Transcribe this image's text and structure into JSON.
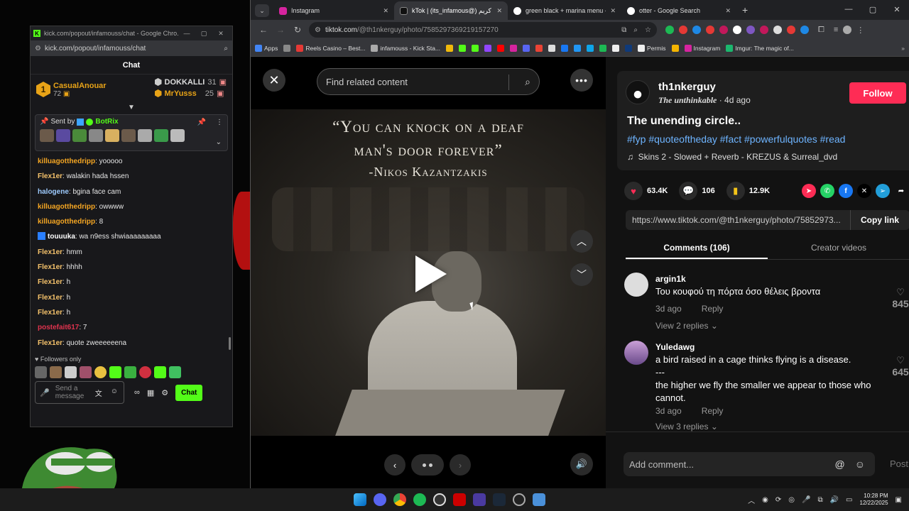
{
  "chat_window": {
    "title": "kick.com/popout/infamouss/chat - Google Chro...",
    "url": "kick.com/popout/infamouss/chat",
    "header": "Chat",
    "leaders": [
      {
        "rank": "1",
        "name": "CasualAnouar",
        "count": "72"
      },
      {
        "name": "DOKKALLI",
        "count": "31"
      },
      {
        "name": "MrYusss",
        "count": "25"
      }
    ],
    "pinned": {
      "label": "Sent by",
      "sender": "BotRix"
    },
    "messages": [
      {
        "user": "killuagotthedripp",
        "color": "#f5a623",
        "text": ": yooooo"
      },
      {
        "user": "Flex1er",
        "color": "#f5c26b",
        "text": ": walakin hada hssen"
      },
      {
        "user": "halogene",
        "color": "#9ecbff",
        "text": ": bgina face cam"
      },
      {
        "user": "killuagotthedripp",
        "color": "#f5a623",
        "text": ": owwww"
      },
      {
        "user": "killuagotthedripp",
        "color": "#f5a623",
        "text": ": 8"
      },
      {
        "user": "touuuka",
        "color": "#ffffff",
        "text": ": wa n9ess shwiaaaaaaaaa"
      },
      {
        "user": "Flex1er",
        "color": "#f5c26b",
        "text": ": hmm"
      },
      {
        "user": "Flex1er",
        "color": "#f5c26b",
        "text": ": hhhh"
      },
      {
        "user": "Flex1er",
        "color": "#f5c26b",
        "text": ": h"
      },
      {
        "user": "Flex1er",
        "color": "#f5c26b",
        "text": ": h"
      },
      {
        "user": "Flex1er",
        "color": "#f5c26b",
        "text": ": h"
      },
      {
        "user": "postefait617",
        "color": "#e0334e",
        "text": ": 7"
      },
      {
        "user": "Flex1er",
        "color": "#f5c26b",
        "text": ": quote zweeeeeena"
      }
    ],
    "followers_only": "Followers only",
    "input_placeholder": "Send a message",
    "chat_button": "Chat"
  },
  "browser": {
    "tabs": [
      {
        "title": "Instagram",
        "color": "#d6249f"
      },
      {
        "title": "kTok | (its_infamous@) كريم",
        "color": "#111111"
      },
      {
        "title": "green black + marina menu - G...",
        "color": "#4285f4"
      },
      {
        "title": "otter - Google Search",
        "color": "#4285f4"
      }
    ],
    "url_host": "tiktok.com",
    "url_path": "/@th1nkerguy/photo/7585297369219157270",
    "bookmarks": [
      "Apps",
      "Reels Casino – Best...",
      "infamouss - Kick Sta...",
      "Permis",
      "Instagram",
      "Imgur: The magic of..."
    ]
  },
  "tiktok": {
    "search_placeholder": "Find related content",
    "quote_line1": "“You can knock on a deaf",
    "quote_line2": "man's door forever”",
    "quote_author": "-Nikos Kazantzakis",
    "username": "th1nkerguy",
    "display_name": "𝒯𝒽𝑒 𝓊𝓃𝓉𝒽𝒾𝓃𝓀𝒶𝒷𝓁𝑒",
    "display_name_plain": "The unthinkable",
    "posted": "· 4d ago",
    "follow": "Follow",
    "post_title": "The unending circle..",
    "hashtags": "#fyp #quoteoftheday #fact #powerfulquotes #read",
    "music": "Skins 2 - Slowed + Reverb - KREZUS & Surreal_dvd",
    "likes": "63.4K",
    "comments_count": "106",
    "saves": "12.9K",
    "link": "https://www.tiktok.com/@th1nkerguy/photo/75852973...",
    "copy_link": "Copy link",
    "tab_comments": "Comments (106)",
    "tab_creator": "Creator videos",
    "comments": [
      {
        "user": "argin1k",
        "text": "Του κουφού τη πόρτα όσο θέλεις βροντα",
        "time": "3d ago",
        "reply": "Reply",
        "view": "View 2 replies",
        "likes": "845"
      },
      {
        "user": "Yuledawg",
        "text": "a bird raised in a cage thinks flying is a disease.\n---\nthe higher we fly the smaller we appear to those who cannot.",
        "time": "3d ago",
        "reply": "Reply",
        "view": "View 3 replies",
        "likes": "645"
      }
    ],
    "add_comment": "Add comment...",
    "post": "Post"
  },
  "taskbar": {
    "time": "10:28 PM",
    "date": "12/22/2025"
  }
}
